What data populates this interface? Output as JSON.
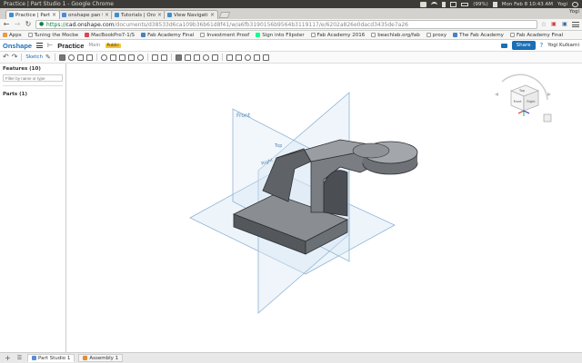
{
  "os": {
    "window_title": "Practice | Part Studio 1 - Google Chrome",
    "battery": "(99%)",
    "datetime": "Mon Feb 8 10:43 AM",
    "user": "Yogi"
  },
  "browser": {
    "tabs": [
      {
        "label": "Practice | Part Studio",
        "active": true
      },
      {
        "label": "onshape pan tilt - Goo",
        "active": false
      },
      {
        "label": "Tutorials | Onshape",
        "active": false
      },
      {
        "label": "View Navigation and",
        "active": false
      }
    ],
    "profile": "Yogi",
    "url_scheme": "https://",
    "url_host": "cad.onshape.com",
    "url_path": "/documents/d38533d6ca109b36b61d8f41/w/a6fb3190156b9564b3119117/e/6202a826e0dacd3435de7a26",
    "bookmarks": [
      {
        "label": "Apps",
        "kind": "apps"
      },
      {
        "label": "Tuning the Mocbe",
        "kind": "page"
      },
      {
        "label": "MacBookPro7-1/S",
        "kind": "site"
      },
      {
        "label": "Fab Academy Final",
        "kind": "site"
      },
      {
        "label": "Investment Proof",
        "kind": "page"
      },
      {
        "label": "Sign into Flipster",
        "kind": "site"
      },
      {
        "label": "Fab Academy 2016",
        "kind": "page"
      },
      {
        "label": "beachlab.org/fab",
        "kind": "page"
      },
      {
        "label": "proxy",
        "kind": "page"
      },
      {
        "label": "The Fab Academy",
        "kind": "site"
      },
      {
        "label": "Fab Academy Final",
        "kind": "page"
      }
    ]
  },
  "onshape": {
    "logo": "Onshape",
    "document_title": "Practice",
    "workspace": "Main",
    "badge": "Public",
    "share_label": "Share",
    "help_label": "?",
    "user": "Yogi Kulkarni",
    "sketch_label": "Sketch"
  },
  "feature_panel": {
    "features_title": "Features (10)",
    "filter_placeholder": "Filter by name or type",
    "parts_title": "Parts (1)"
  },
  "viewport": {
    "plane_labels": {
      "front": "Front",
      "top": "Top",
      "right": "Right"
    },
    "view_cube": {
      "top": "Top",
      "front": "Front",
      "right": "Right"
    }
  },
  "bottom_tabs": [
    {
      "label": "Part Studio 1",
      "active": true,
      "kind": "part"
    },
    {
      "label": "Assembly 1",
      "active": false,
      "kind": "assembly"
    }
  ]
}
